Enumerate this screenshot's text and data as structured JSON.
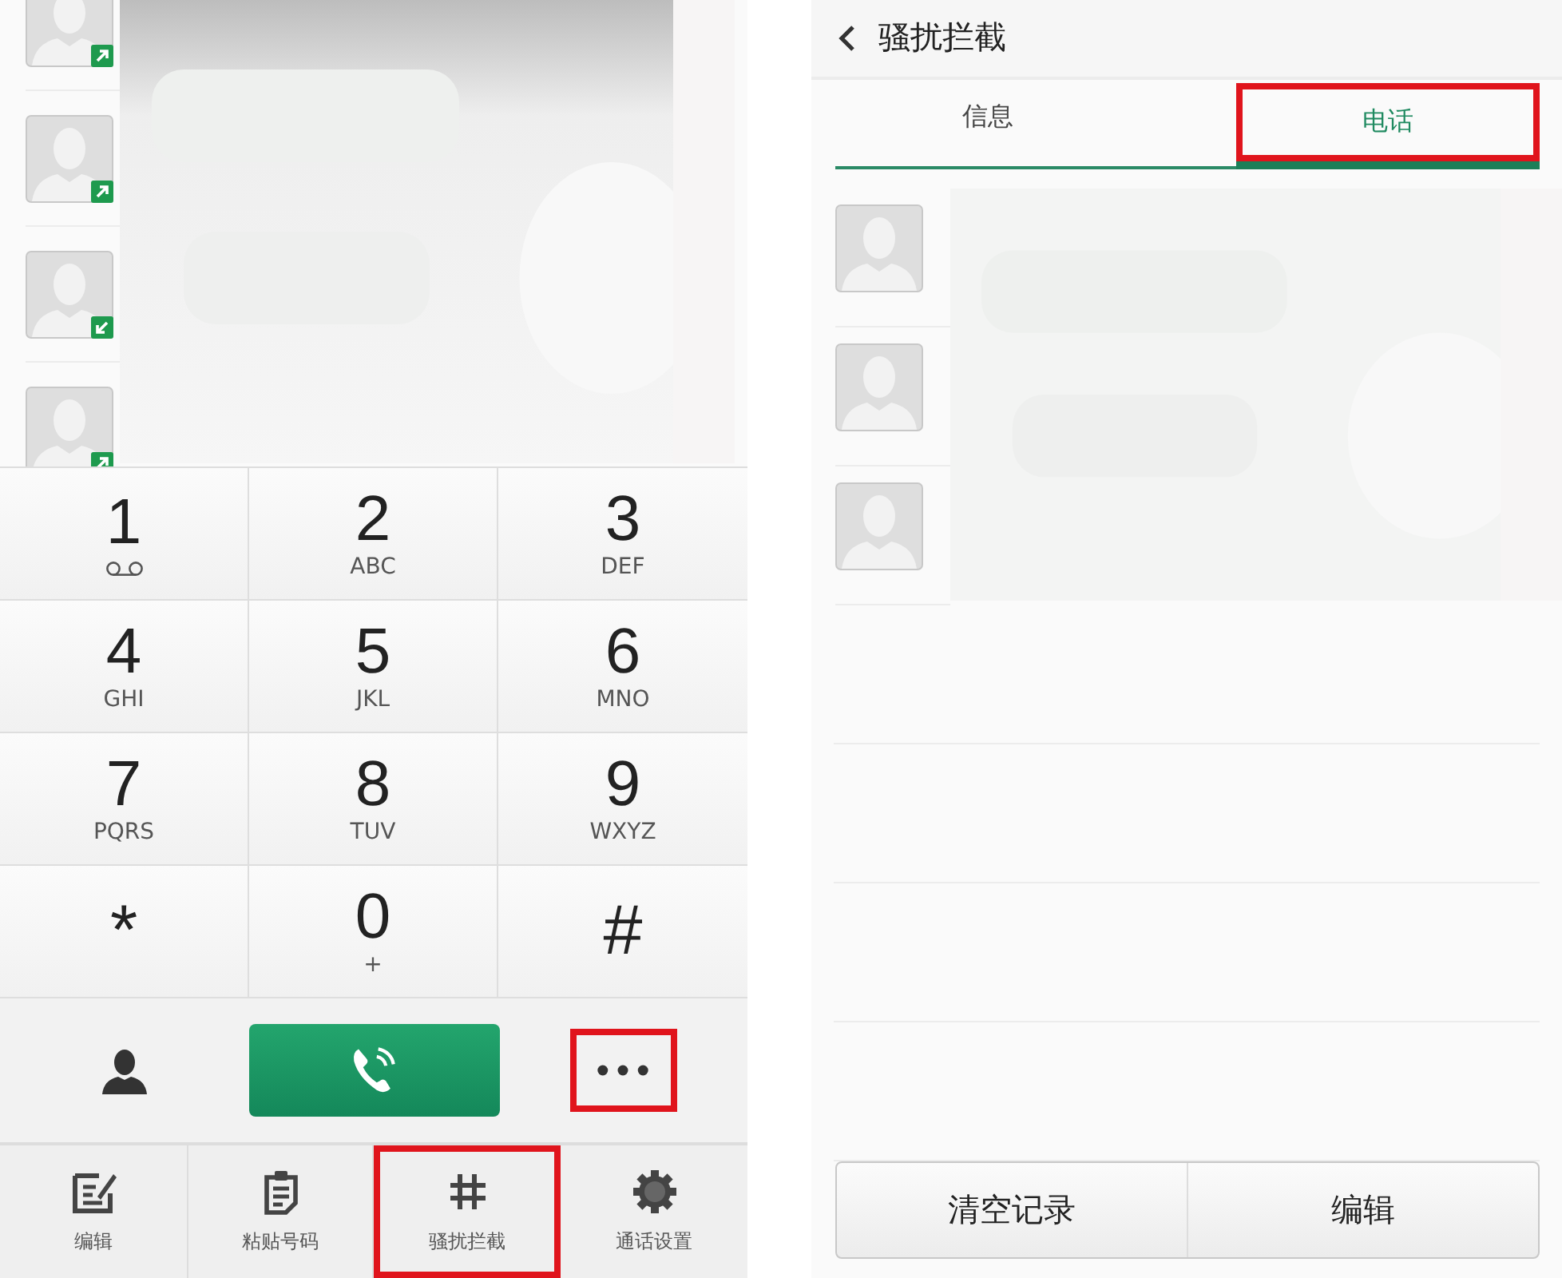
{
  "call_log": {
    "rows": [
      {
        "kind": "outgoing"
      },
      {
        "kind": "outgoing"
      },
      {
        "kind": "incoming"
      },
      {
        "kind": "outgoing"
      }
    ],
    "blurred": {
      "kind": "picture"
    }
  },
  "keypad": [
    {
      "digit": "1",
      "kind": "voicemail"
    },
    {
      "digit": "2",
      "letters": "ABC",
      "kind": "letters"
    },
    {
      "digit": "3",
      "letters": "DEF",
      "kind": "letters"
    },
    {
      "digit": "4",
      "letters": "GHI",
      "kind": "letters"
    },
    {
      "digit": "5",
      "letters": "JKL",
      "kind": "letters"
    },
    {
      "digit": "6",
      "letters": "MNO",
      "kind": "letters"
    },
    {
      "digit": "7",
      "letters": "PQRS",
      "kind": "letters"
    },
    {
      "digit": "8",
      "letters": "TUV",
      "kind": "letters"
    },
    {
      "digit": "9",
      "letters": "WXYZ",
      "kind": "letters"
    },
    {
      "digit": "*",
      "kind": "symbol"
    },
    {
      "digit": "0",
      "letters": "+",
      "kind": "letters"
    },
    {
      "digit": "#",
      "kind": "symbol"
    }
  ],
  "action_row": {
    "more_highlighted": true
  },
  "bottom_bar": [
    {
      "label": "编辑",
      "highlighted": false
    },
    {
      "label": "粘贴号码",
      "highlighted": false
    },
    {
      "label": "骚扰拦截",
      "highlighted": true
    },
    {
      "label": "通话设置",
      "highlighted": false
    }
  ],
  "blocker": {
    "title": "骚扰拦截",
    "tabs": [
      {
        "label": "信息",
        "selected": false,
        "highlighted": false
      },
      {
        "label": "电话",
        "selected": true,
        "highlighted": true
      }
    ],
    "rows": [
      {
        "kind": "contact"
      },
      {
        "kind": "contact"
      },
      {
        "kind": "contact"
      }
    ],
    "blurred": {
      "kind": "picture"
    },
    "buttons": [
      "清空记录",
      "编辑"
    ]
  }
}
